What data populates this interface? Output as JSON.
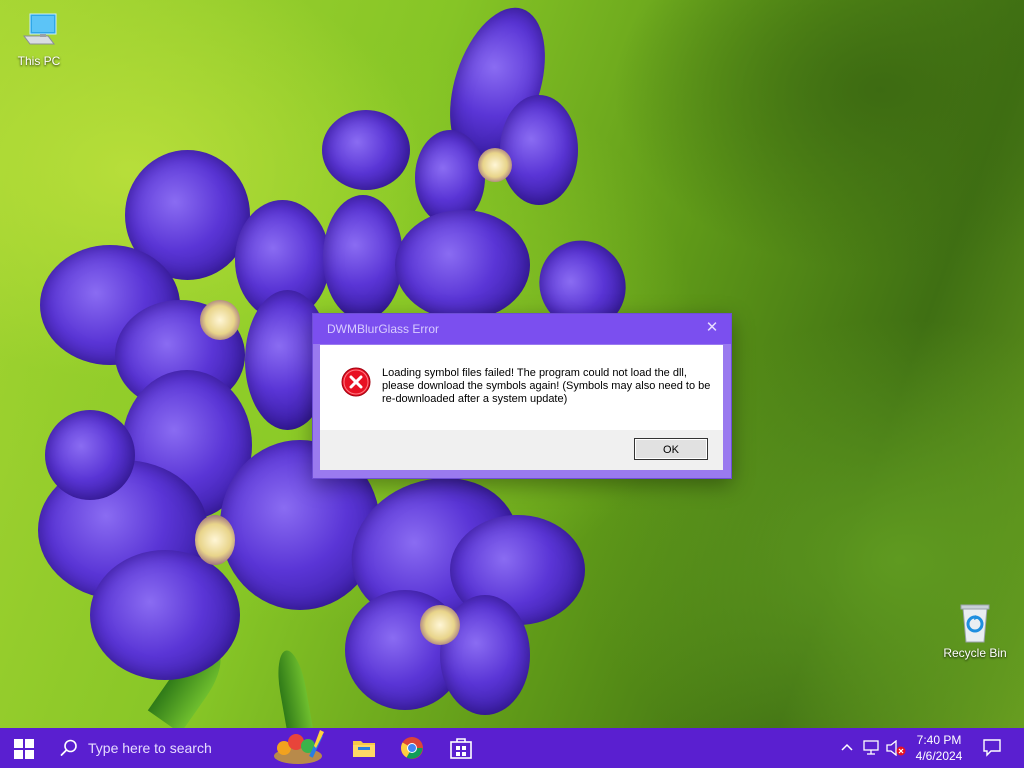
{
  "desktop": {
    "icons": [
      {
        "label": "This PC",
        "icon": "computer-icon"
      },
      {
        "label": "Recycle Bin",
        "icon": "recycle-bin-icon"
      }
    ]
  },
  "dialog": {
    "title": "DWMBlurGlass Error",
    "close_label": "✕",
    "message": "Loading symbol files failed! The program could not load the dll, please download the symbols again! (Symbols may also need to be re-downloaded after a system update)",
    "ok_label": "OK",
    "icon": "error-icon",
    "titlebar_color": "#7b4fef"
  },
  "taskbar": {
    "color": "#5a1fd0",
    "search_placeholder": "Type here to search",
    "pinned_apps": [
      "paint-app-icon",
      "file-explorer-icon",
      "chrome-icon",
      "store-app-icon"
    ],
    "tray": {
      "time": "7:40 PM",
      "date": "4/6/2024",
      "icons": [
        "show-hidden-icons-chevron-icon",
        "network-icon",
        "volume-muted-icon",
        "notification-icon"
      ]
    }
  }
}
